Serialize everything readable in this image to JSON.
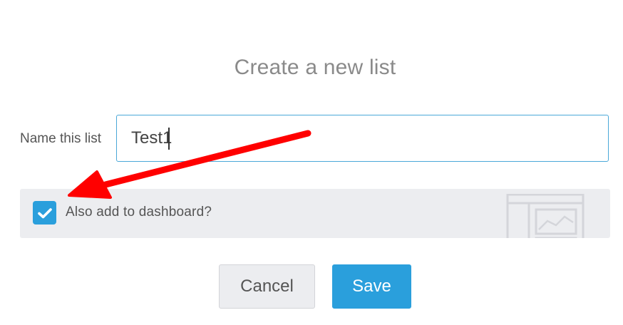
{
  "dialog": {
    "title": "Create a new list"
  },
  "name_field": {
    "label": "Name this list",
    "value": "Test1"
  },
  "dashboard_option": {
    "label": "Also add to dashboard?",
    "checked": true,
    "illustration_icon": "dashboard-illustration-icon"
  },
  "actions": {
    "cancel_label": "Cancel",
    "save_label": "Save"
  },
  "colors": {
    "accent": "#2a9fdc",
    "annotation_arrow": "#ff0000",
    "panel_bg": "#ecedf0"
  }
}
